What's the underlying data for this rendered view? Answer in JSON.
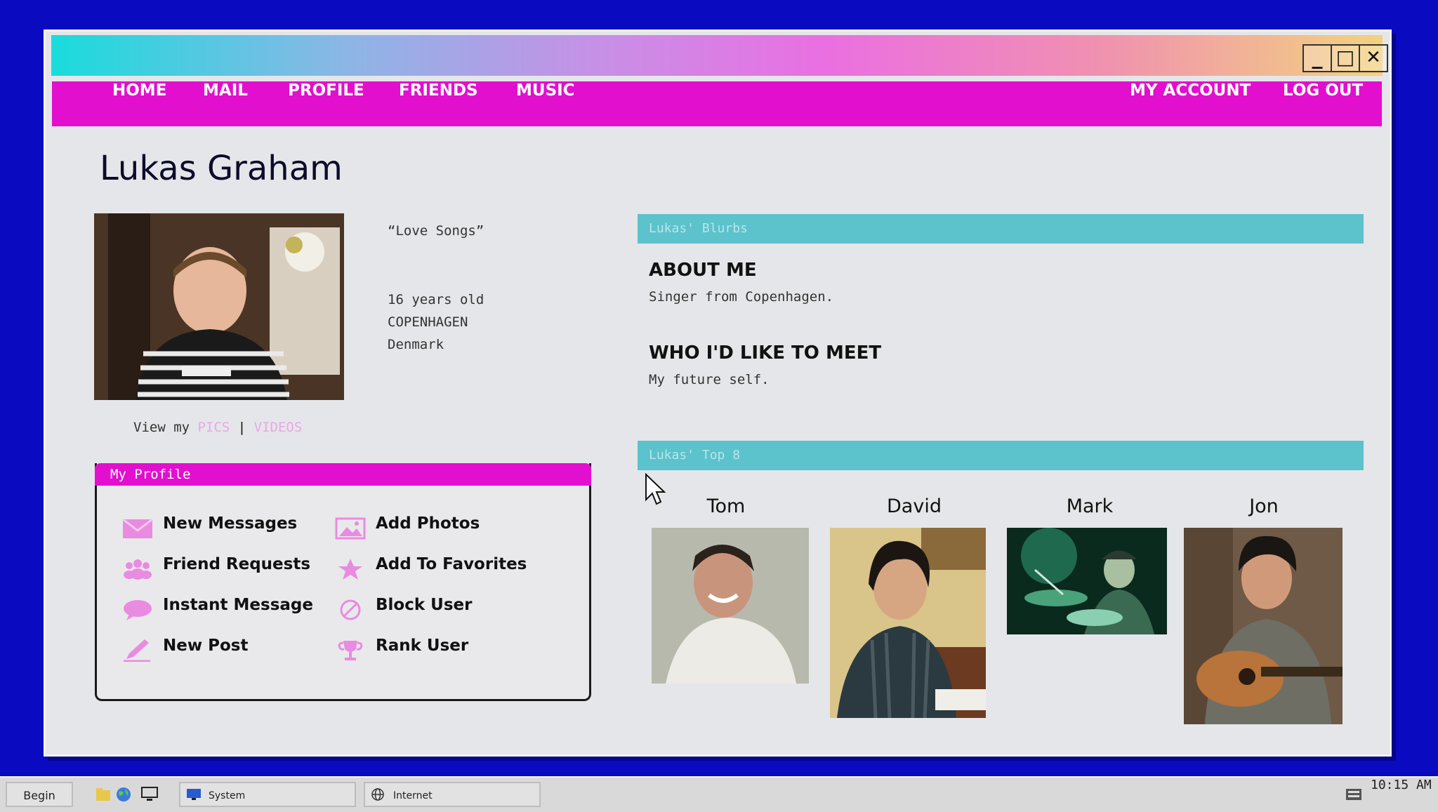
{
  "window": {
    "controls": {
      "minimize": "_",
      "maximize": "□",
      "close": "✕"
    }
  },
  "nav": {
    "left": [
      "HOME",
      "MAIL",
      "PROFILE",
      "FRIENDS",
      "MUSIC"
    ],
    "right": [
      "MY ACCOUNT",
      "LOG OUT"
    ]
  },
  "profile": {
    "name": "Lukas Graham",
    "headline": "“Love Songs”",
    "age": "16 years old",
    "city": "COPENHAGEN",
    "country": "Denmark",
    "view_my": "View my",
    "pics": "PICS",
    "separator": "|",
    "videos": "VIDEOS"
  },
  "my_profile": {
    "title": "My Profile",
    "items": [
      {
        "label": "New Messages",
        "icon": "envelope-icon"
      },
      {
        "label": "Add Photos",
        "icon": "photo-icon"
      },
      {
        "label": "Friend Requests",
        "icon": "people-icon"
      },
      {
        "label": "Add To Favorites",
        "icon": "star-icon"
      },
      {
        "label": "Instant Message",
        "icon": "chat-bubble-icon"
      },
      {
        "label": "Block User",
        "icon": "block-icon"
      },
      {
        "label": "New Post",
        "icon": "pencil-icon"
      },
      {
        "label": "Rank User",
        "icon": "trophy-icon"
      }
    ]
  },
  "blurbs": {
    "header": "Lukas' Blurbs",
    "about_title": "ABOUT ME",
    "about_text": "Singer from Copenhagen.",
    "meet_title": "WHO I'D LIKE TO MEET",
    "meet_text": "My future self."
  },
  "top8": {
    "header": "Lukas' Top 8",
    "friends": [
      "Tom",
      "David",
      "Mark",
      "Jon"
    ]
  },
  "taskbar": {
    "start": "Begin",
    "tasks": [
      "System",
      "Internet"
    ],
    "time": "10:15 AM"
  },
  "colors": {
    "desktop": "#0a0ac0",
    "nav": "#e30fcf",
    "section_bar": "#5cc2cc",
    "link": "#e7a9e6",
    "icon": "#e98be0"
  }
}
